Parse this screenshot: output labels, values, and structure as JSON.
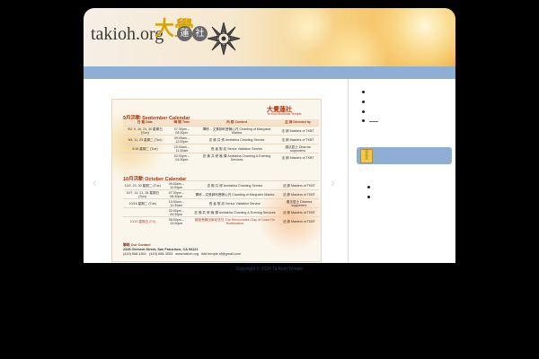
{
  "header": {
    "logo_text": "takioh.org",
    "logo_chars": "大覺",
    "seal_1": "蓮",
    "seal_2": "社"
  },
  "slider": {
    "prev_label": "‹",
    "next_label": "›",
    "logo": "大覺蓮社",
    "logo_sub": "Ta Kioh Buddhist Temple",
    "september": {
      "title": "9月活動  September Calendar",
      "headers": [
        "日 期 Date",
        "時 間 Time",
        "內 容 Content",
        "主 持 Directed by"
      ],
      "rows": [
        [
          "9/2, 9, 16, 23, 30 星期日 (Sun)",
          "07:30pm – 08:30pm",
          "禪修 – 文殊師利菩薩心咒 Chanting of Manjushri Mantra",
          "法 師 Masters of TKBT"
        ],
        [
          "9/4, 11, 25 星期二 (Tue)",
          "09:00am – 12:00pm",
          "念 佛 共 修 Amitabha Chanting Service",
          "法 師 Masters of TKBT"
        ],
        [
          "9/18 星期二 (Tue)",
          "10:00am – 11:30am",
          "長 者 慰 訪 Senior Visitation Service",
          "護法居士 Dharma supporters"
        ],
        [
          "",
          "02:00pm – 04:30pm",
          "念 佛 共 修 晚 課 Amitabha Chanting & Evening Services",
          "法 師 Masters of TKBT"
        ]
      ]
    },
    "october": {
      "title": "10月活動  October Calendar",
      "rows": [
        [
          "10/2, 23, 30 星期二 (Tue)",
          "09:00am – 12:00pm",
          "念 佛 共 修 Amitabha Chanting Service",
          "法 師 Masters of TKBT"
        ],
        [
          "10/7, 14, 21, 28 星期日 (Sun)",
          "07:30pm – 08:30pm",
          "禪修 – 文殊師利菩薩心咒 Chanting of Manjushri Mantra",
          "法 師 Masters of TKBT"
        ],
        [
          "10/16 星期二 (Tue)",
          "10:00am – 11:30am",
          "長 者 慰 訪 Senior Visitation Service",
          "護法居士 Dharma supporters"
        ],
        [
          "",
          "02:00pm – 04:30pm",
          "念 佛 共 修 晚 課 Amitabha Chanting & Evening Services",
          "法 師 Masters of TKBT"
        ],
        [
          "10/19 星期五 (Fri)",
          "08:00pm – 12:00pm",
          "觀音菩薩出家紀念日 The Renunciation Day of Guan Yin Bodhisattva",
          "法 師 Masters of TKBT"
        ]
      ]
    },
    "contact": {
      "title": "聯絡  Our Contact",
      "address": "2328 Clement Street, San Francisco, CA  94121",
      "phone": "(415) 668-1801",
      "fax": "(415) 668-3953",
      "web": "www.takioh.org",
      "email": "tkbt.temple.sf@gmail.com"
    }
  },
  "footer": {
    "copyright": "Copyright © 2024 Ta Kioh Temple"
  }
}
